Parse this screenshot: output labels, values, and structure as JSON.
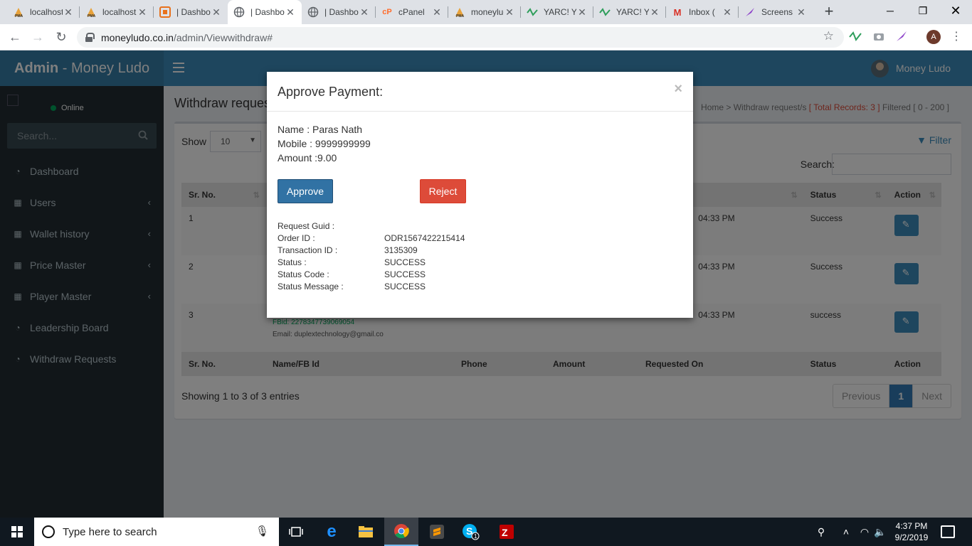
{
  "browser": {
    "tabs": [
      {
        "title": "localhost",
        "icon": "phpmyadmin-icon",
        "active": false
      },
      {
        "title": "localhost",
        "icon": "phpmyadmin-icon",
        "active": false
      },
      {
        "title": "| Dashboard",
        "icon": "orange-box-icon",
        "active": false
      },
      {
        "title": "| Dashboard",
        "icon": "globe-icon",
        "active": true
      },
      {
        "title": "| Dashboard",
        "icon": "globe-icon",
        "active": false
      },
      {
        "title": "cPanel",
        "icon": "cpanel-icon",
        "active": false
      },
      {
        "title": "moneyludo",
        "icon": "phpmyadmin-icon",
        "active": false
      },
      {
        "title": "YARC! Yet",
        "icon": "yarc-icon",
        "active": false
      },
      {
        "title": "YARC! Yet",
        "icon": "yarc-icon",
        "active": false
      },
      {
        "title": "Inbox (",
        "icon": "gmail-icon",
        "active": false
      },
      {
        "title": "Screens",
        "icon": "quill-icon",
        "active": false
      }
    ],
    "url_host": "moneyludo.co.in",
    "url_path": "/admin/Viewwithdraw#",
    "profile_initial": "A"
  },
  "header": {
    "brand_bold": "Admin",
    "brand_rest": " - Money Ludo",
    "user_name": "Money Ludo"
  },
  "sidebar": {
    "status": "Online",
    "search_placeholder": "Search...",
    "items": [
      {
        "label": "Dashboard",
        "icon": "dashboard-icon",
        "has_submenu": false
      },
      {
        "label": "Users",
        "icon": "table-icon",
        "has_submenu": true
      },
      {
        "label": "Wallet history",
        "icon": "table-icon",
        "has_submenu": true
      },
      {
        "label": "Price Master",
        "icon": "table-icon",
        "has_submenu": true
      },
      {
        "label": "Player Master",
        "icon": "table-icon",
        "has_submenu": true
      },
      {
        "label": "Leadership Board",
        "icon": "dashboard-icon",
        "has_submenu": false
      },
      {
        "label": "Withdraw Requests",
        "icon": "dashboard-icon",
        "has_submenu": false
      }
    ]
  },
  "page": {
    "title": "Withdraw reques",
    "breadcrumb_home": "Home",
    "breadcrumb_current": "Withdraw request/s",
    "total_records": "[ Total Records: 3 ]",
    "filtered": "Filtered [ 0 - 200 ]",
    "show_label": "Show",
    "show_value": "10",
    "filter_label": "Filter",
    "search_label": "Search:",
    "columns": [
      "Sr. No.",
      "Name/FB Id",
      "Phone",
      "Amount",
      "Requested On",
      "Status",
      "Action"
    ],
    "header_visible": [
      "Sr. No.",
      "",
      "",
      "",
      "On",
      "Status",
      "Action"
    ],
    "rows": [
      {
        "sr": "1",
        "requested_on": "04:33 PM",
        "status": "Success"
      },
      {
        "sr": "2",
        "requested_on": "04:33 PM",
        "status": "Success"
      },
      {
        "sr": "3",
        "requested_on": "04:33 PM",
        "status": "success",
        "fbid": "FBid: 2278347739069054",
        "email": "Email: duplextechnology@gmail.co"
      }
    ],
    "showing": "Showing 1 to 3 of 3 entries",
    "pager": {
      "previous": "Previous",
      "current": "1",
      "next": "Next"
    }
  },
  "modal": {
    "title": "Approve Payment:",
    "close": "×",
    "name_line": "Name : Paras Nath",
    "mobile_line": "Mobile : 9999999999",
    "amount_line": "Amount :9.00",
    "approve_label": "Approve",
    "reject_label": "Reject",
    "details": [
      {
        "label": "Request Guid :",
        "value": ""
      },
      {
        "label": "Order ID :",
        "value": "ODR1567422215414"
      },
      {
        "label": "Transaction ID :",
        "value": "3135309"
      },
      {
        "label": "Status :",
        "value": "SUCCESS"
      },
      {
        "label": "Status Code :",
        "value": "SUCCESS"
      },
      {
        "label": "Status Message :",
        "value": "SUCCESS"
      }
    ]
  },
  "taskbar": {
    "search_placeholder": "Type here to search",
    "time": "4:37 PM",
    "date": "9/2/2019"
  }
}
